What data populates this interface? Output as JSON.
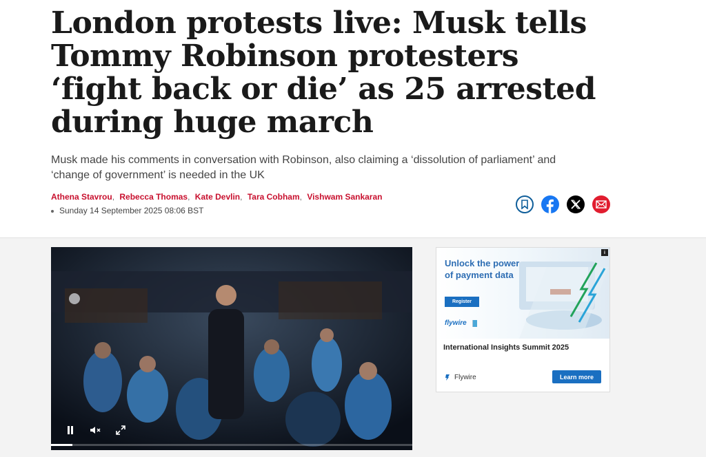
{
  "article": {
    "headline": "London protests live: Musk tells Tommy Robinson protesters ‘fight back or die’ as 25 arrested during huge march",
    "standfirst": "Musk made his comments in conversation with Robinson, also claiming a ‘dissolution of parliament’ and ‘change of government’ is needed in the UK",
    "authors": [
      "Athena Stavrou",
      "Rebecca Thomas",
      "Kate Devlin",
      "Tara Cobham",
      "Vishwam Sankaran"
    ],
    "date": "Sunday 14 September 2025 08:06 BST"
  },
  "share": {
    "icons": [
      "bookmark-icon",
      "facebook-icon",
      "x-icon",
      "email-icon"
    ],
    "colors": {
      "bookmark": "#0f5e9a",
      "facebook": "#1877f2",
      "x": "#000000",
      "email": "#e11d2f"
    }
  },
  "video": {
    "progress": 0.06,
    "controls": [
      "pause-icon",
      "mute-icon",
      "fullscreen-icon"
    ]
  },
  "ad": {
    "headline": "Unlock the power of payment data",
    "register_label": "Register",
    "logo_text": "flywire",
    "title": "International Insights Summit 2025",
    "brand": "Flywire",
    "cta_label": "Learn more",
    "info_label": "i"
  },
  "colors": {
    "accent_red": "#c8102e",
    "ad_blue": "#1a6fc1"
  }
}
